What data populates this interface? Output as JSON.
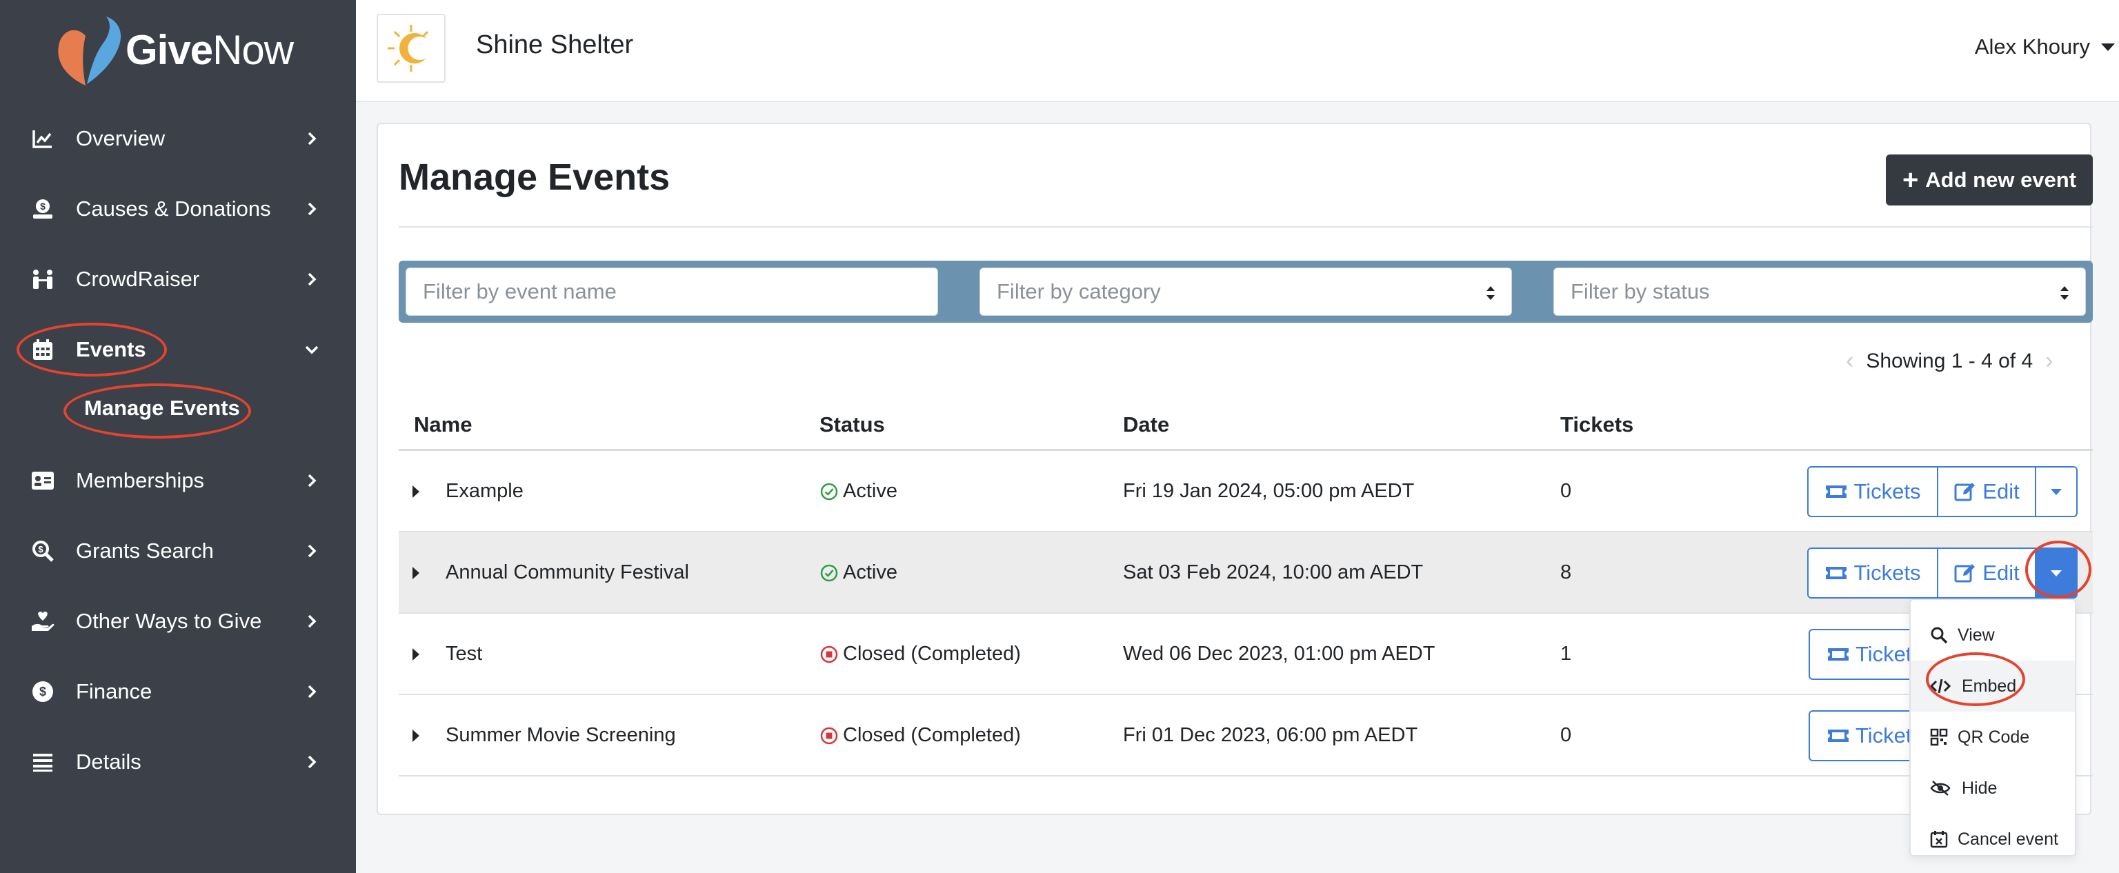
{
  "brand": {
    "name_give": "Give",
    "name_now": "Now"
  },
  "sidebar": {
    "items": [
      {
        "label": "Overview",
        "icon": "chart-line-icon"
      },
      {
        "label": "Causes & Donations",
        "icon": "donate-icon"
      },
      {
        "label": "CrowdRaiser",
        "icon": "people-icon"
      },
      {
        "label": "Events",
        "icon": "calendar-icon",
        "expanded": true
      },
      {
        "label": "Memberships",
        "icon": "id-card-icon"
      },
      {
        "label": "Grants Search",
        "icon": "search-dollar-icon"
      },
      {
        "label": "Other Ways to Give",
        "icon": "hand-heart-icon"
      },
      {
        "label": "Finance",
        "icon": "coin-icon"
      },
      {
        "label": "Details",
        "icon": "list-icon"
      }
    ],
    "sub_item": "Manage Events"
  },
  "header": {
    "org_name": "Shine Shelter",
    "user_name": "Alex Khoury"
  },
  "main": {
    "title": "Manage Events",
    "add_button": "Add new event",
    "filters": {
      "name_placeholder": "Filter by event name",
      "category_placeholder": "Filter by category",
      "status_placeholder": "Filter by status"
    },
    "pager": "Showing 1 - 4 of 4",
    "columns": [
      "Name",
      "Status",
      "Date",
      "Tickets"
    ],
    "rows": [
      {
        "name": "Example",
        "status": "Active",
        "status_kind": "active",
        "date": "Fri 19 Jan 2024, 05:00 pm AEDT",
        "tickets": "0"
      },
      {
        "name": "Annual Community Festival",
        "status": "Active",
        "status_kind": "active",
        "date": "Sat 03 Feb 2024, 10:00 am AEDT",
        "tickets": "8"
      },
      {
        "name": "Test",
        "status": "Closed (Completed)",
        "status_kind": "closed",
        "date": "Wed 06 Dec 2023, 01:00 pm AEDT",
        "tickets": "1"
      },
      {
        "name": "Summer Movie Screening",
        "status": "Closed (Completed)",
        "status_kind": "closed",
        "date": "Fri 01 Dec 2023, 06:00 pm AEDT",
        "tickets": "0"
      }
    ],
    "row_actions": {
      "tickets": "Tickets",
      "tickets_truncated": "Ticket",
      "edit": "Edit"
    }
  },
  "dropdown": {
    "items": [
      {
        "label": "View",
        "icon": "magnifier-icon"
      },
      {
        "label": "Embed",
        "icon": "code-icon"
      },
      {
        "label": "QR Code",
        "icon": "qr-code-icon"
      },
      {
        "label": "Hide",
        "icon": "eye-slash-icon"
      },
      {
        "label": "Cancel event",
        "icon": "calendar-x-icon"
      }
    ]
  },
  "colors": {
    "sidebar": "#3b4049",
    "accent": "#3d7cdb",
    "annotation": "#e2442f",
    "filter_bar": "#6b93b0",
    "active": "#2f9e44",
    "closed": "#d6363a"
  }
}
